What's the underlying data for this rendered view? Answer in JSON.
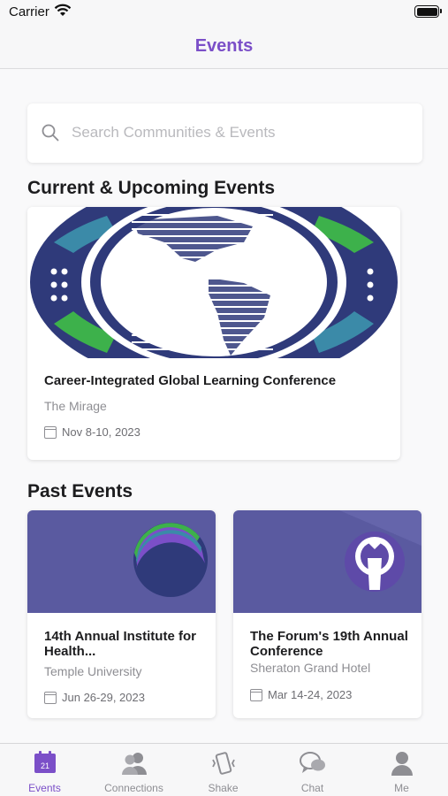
{
  "status_bar": {
    "carrier": "Carrier"
  },
  "nav": {
    "title": "Events"
  },
  "search": {
    "placeholder": "Search Communities & Events"
  },
  "sections": {
    "current_title": "Current & Upcoming Events",
    "past_title": "Past Events"
  },
  "current_events": [
    {
      "title": "Career-Integrated Global Learning Conference",
      "venue": "The Mirage",
      "date": "Nov  8-10, 2023"
    }
  ],
  "past_events": [
    {
      "title": "14th Annual Institute for Health...",
      "venue": "Temple University",
      "date": "Jun 26-29, 2023"
    },
    {
      "title": "The Forum's 19th Annual Conference",
      "venue": "Sheraton Grand Hotel",
      "date": "Mar 14-24, 2023"
    }
  ],
  "tabs": [
    {
      "label": "Events",
      "icon": "calendar-icon",
      "badge": "21",
      "active": true
    },
    {
      "label": "Connections",
      "icon": "people-icon",
      "active": false
    },
    {
      "label": "Shake",
      "icon": "phone-shake-icon",
      "active": false
    },
    {
      "label": "Chat",
      "icon": "chat-icon",
      "active": false
    },
    {
      "label": "Me",
      "icon": "person-icon",
      "active": false
    }
  ],
  "colors": {
    "accent": "#7b4fc8",
    "banner_navy": "#2f3a7a",
    "banner_green": "#3db14b",
    "banner_teal": "#3b8aa8",
    "past_banner_purple": "#5a5aa0"
  }
}
